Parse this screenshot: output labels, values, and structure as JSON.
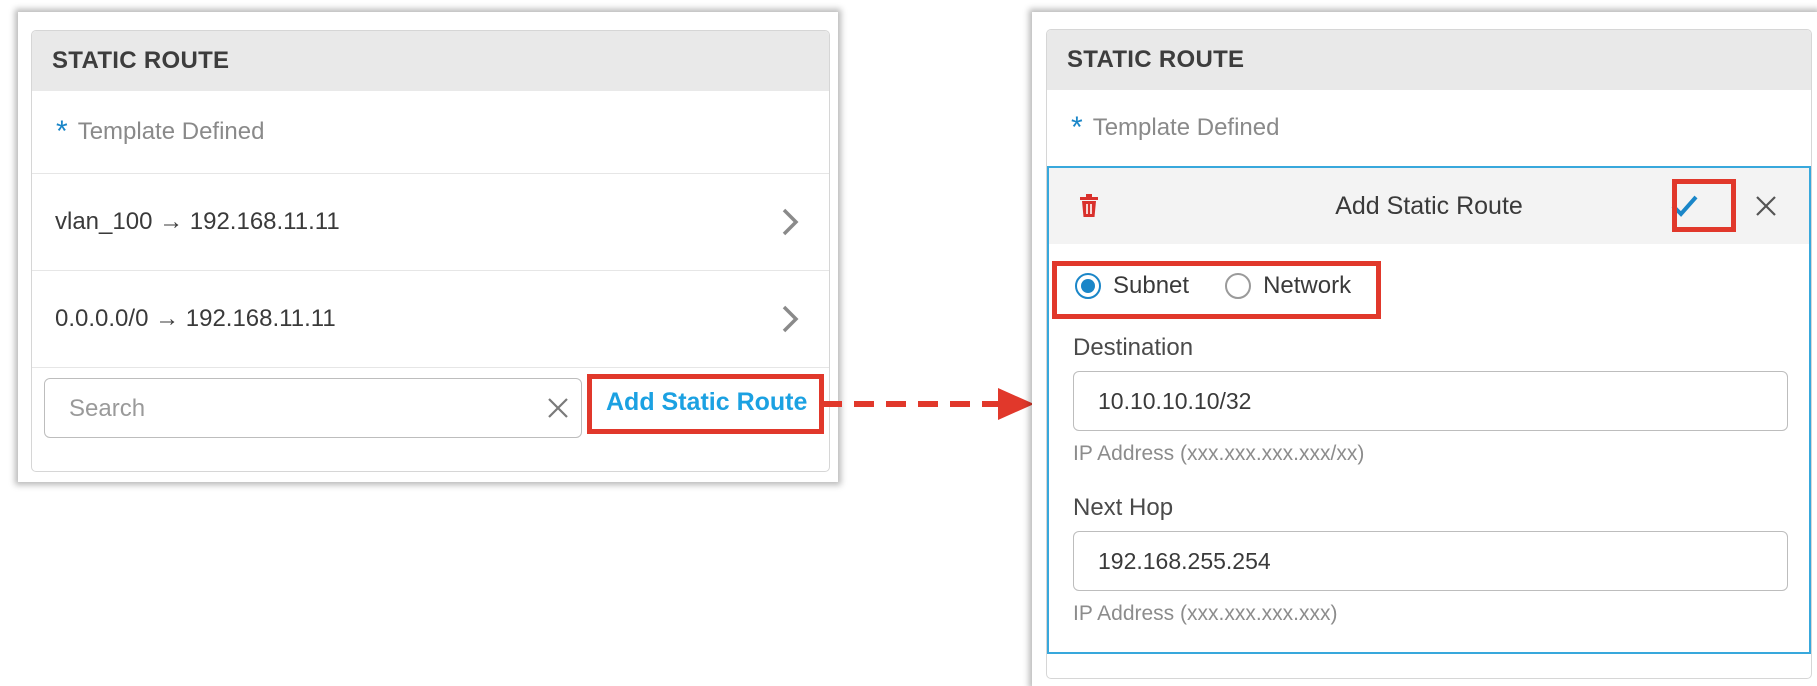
{
  "left_card": {
    "header": "STATIC ROUTE",
    "template_label": "Template Defined",
    "routes": [
      {
        "label": "vlan_100 → 192.168.11.11"
      },
      {
        "label": "0.0.0.0/0 → 192.168.11.11"
      }
    ],
    "search_placeholder": "Search",
    "add_link": "Add Static Route"
  },
  "right_card": {
    "header": "STATIC ROUTE",
    "template_label": "Template Defined",
    "panel_title": "Add Static Route",
    "radio_options": [
      {
        "label": "Subnet",
        "selected": true
      },
      {
        "label": "Network",
        "selected": false
      }
    ],
    "destination": {
      "label": "Destination",
      "value": "10.10.10.10/32",
      "hint": "IP Address (xxx.xxx.xxx.xxx/xx)"
    },
    "next_hop": {
      "label": "Next Hop",
      "value": "192.168.255.254",
      "hint": "IP Address (xxx.xxx.xxx.xxx)"
    }
  },
  "colors": {
    "accent_blue": "#1ba1e2",
    "highlight_red": "#e1382b",
    "panel_border": "#38a8dc",
    "trash_red": "#d9302c"
  },
  "icons": [
    "star-icon",
    "chevron-right-icon",
    "clear-icon",
    "trash-icon",
    "check-icon",
    "close-icon",
    "arrow-right-icon"
  ]
}
